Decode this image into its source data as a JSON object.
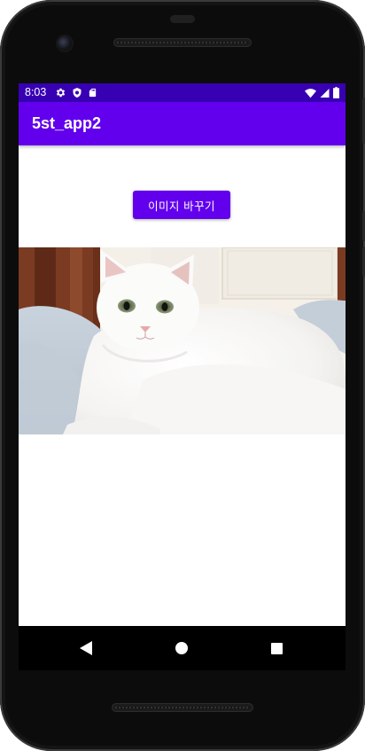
{
  "status_bar": {
    "time": "8:03",
    "icons_left": [
      "settings-gear-icon",
      "shield-icon",
      "sd-card-icon"
    ],
    "icons_right": [
      "wifi-icon",
      "cell-signal-icon",
      "battery-icon"
    ]
  },
  "app_bar": {
    "title": "5st_app2"
  },
  "main": {
    "change_image_button_label": "이미지 바꾸기",
    "image_name": "white-cat-photo"
  },
  "nav_bar": {
    "buttons": [
      "back-icon",
      "home-icon",
      "recents-icon"
    ]
  },
  "colors": {
    "status_bar": "#3700B3",
    "app_bar": "#6200EE",
    "button": "#6200EE",
    "content_background": "#FFFFFF",
    "nav_bar": "#000000"
  }
}
